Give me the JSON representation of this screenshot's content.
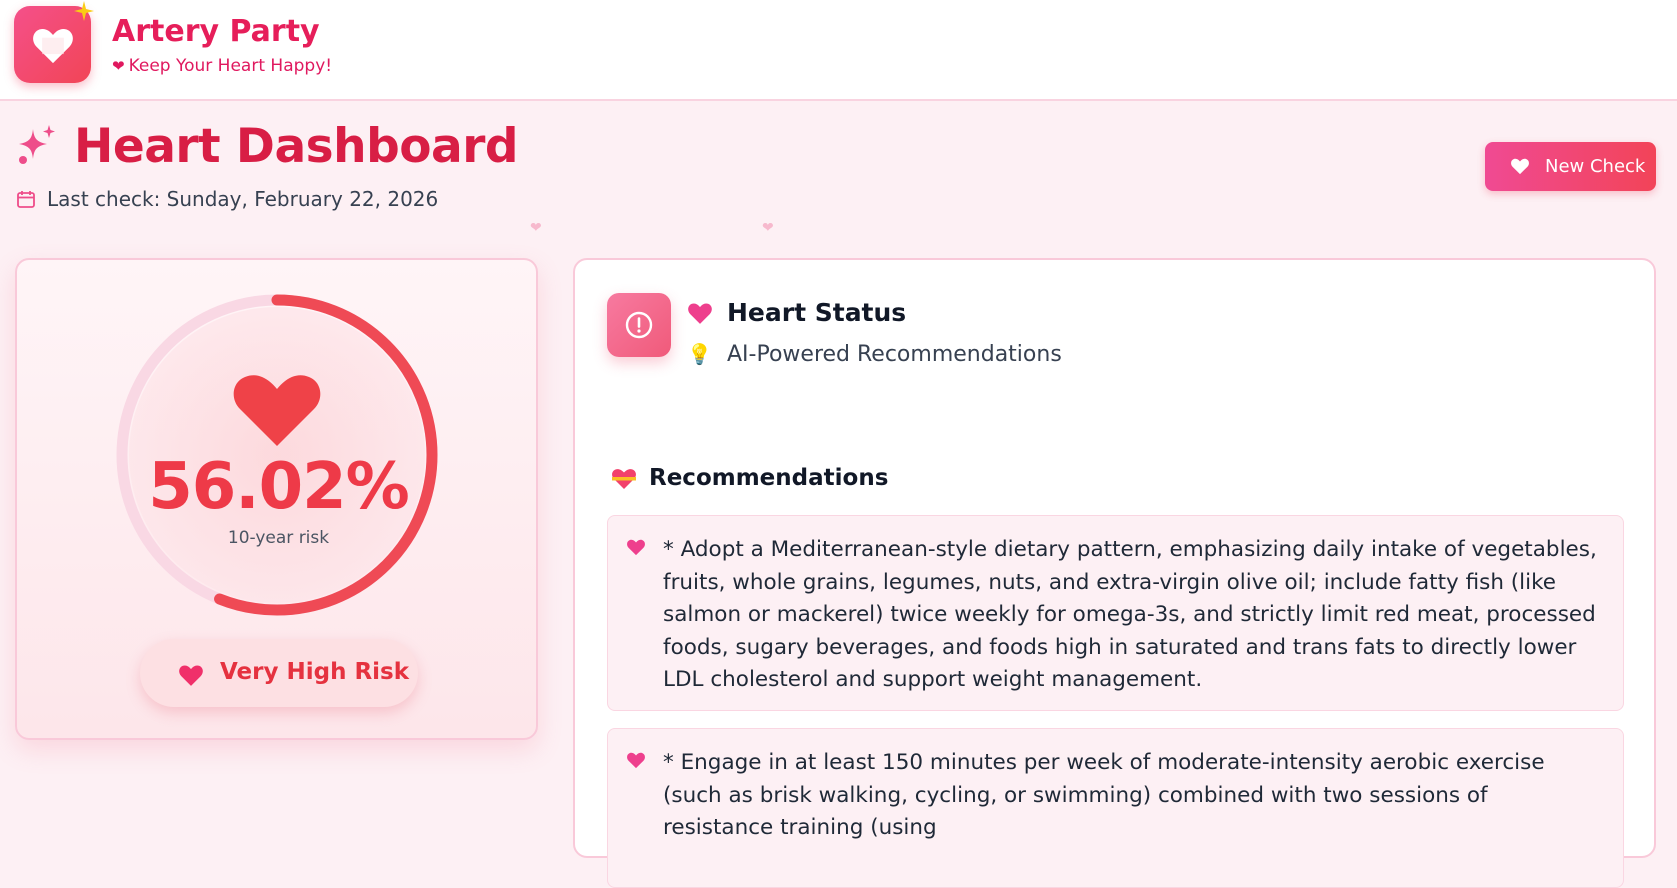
{
  "app": {
    "name": "Artery Party",
    "tagline": "Keep Your Heart Happy!"
  },
  "header": {
    "title": "Heart Dashboard",
    "last_check": "Last check: Sunday, February 22, 2026",
    "new_check_label": "New Check"
  },
  "risk": {
    "percent_text": "56.02%",
    "percent_value": 56.02,
    "subtitle": "10-year risk",
    "level": "Very High Risk"
  },
  "status": {
    "title": "Heart Status",
    "subtitle": "AI-Powered Recommendations",
    "recommendations_heading": "Recommendations",
    "recommendations": [
      "* Adopt a Mediterranean-style dietary pattern, emphasizing daily intake of vegetables, fruits, whole grains, legumes, nuts, and extra-virgin olive oil; include fatty fish (like salmon or mackerel) twice weekly for omega-3s, and strictly limit red meat, processed foods, sugary beverages, and foods high in saturated and trans fats to directly lower LDL cholesterol and support weight management.",
      "* Engage in at least 150 minutes per week of moderate-intensity aerobic exercise (such as brisk walking, cycling, or swimming) combined with two sessions of resistance training (using"
    ]
  },
  "colors": {
    "brand": "#e61e5a",
    "title": "#d81e45",
    "risk": "#ee3a48",
    "accent_pink": "#f04a93"
  },
  "icons": {
    "logo": "heart-icon",
    "sparkle": "sparkle-icon",
    "calendar": "calendar-icon",
    "alert": "alert-circle-icon",
    "bulb": "lightbulb-icon",
    "gift_heart": "heart-with-ribbon-icon"
  }
}
